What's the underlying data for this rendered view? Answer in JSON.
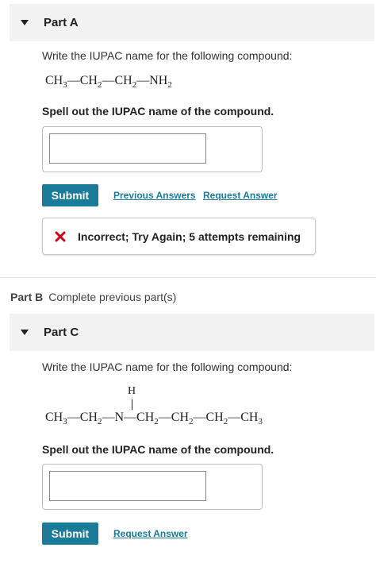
{
  "part_a": {
    "title": "Part A",
    "question": "Write the IUPAC name for the following compound:",
    "formula": [
      {
        "t": "CH",
        "s": "3"
      },
      {
        "b": "—"
      },
      {
        "t": "CH",
        "s": "2"
      },
      {
        "b": "—"
      },
      {
        "t": "CH",
        "s": "2"
      },
      {
        "b": "—"
      },
      {
        "t": "NH",
        "s": "2"
      }
    ],
    "prompt": "Spell out the IUPAC name of the compound.",
    "answer_value": "",
    "submit_label": "Submit",
    "previous_answers_label": "Previous Answers",
    "request_answer_label": "Request Answer",
    "feedback": "Incorrect; Try Again; 5 attempts remaining"
  },
  "part_b": {
    "label": "Part B",
    "text": "Complete previous part(s)"
  },
  "part_c": {
    "title": "Part C",
    "question": "Write the IUPAC name for the following compound:",
    "formula_h": "H",
    "formula": [
      {
        "t": "CH",
        "s": "3"
      },
      {
        "b": "—"
      },
      {
        "t": "CH",
        "s": "2"
      },
      {
        "b": "—"
      },
      {
        "t": "N",
        "s": ""
      },
      {
        "b": "—"
      },
      {
        "t": "CH",
        "s": "2"
      },
      {
        "b": "—"
      },
      {
        "t": "CH",
        "s": "2"
      },
      {
        "b": "—"
      },
      {
        "t": "CH",
        "s": "2"
      },
      {
        "b": "—"
      },
      {
        "t": "CH",
        "s": "3"
      }
    ],
    "prompt": "Spell out the IUPAC name of the compound.",
    "answer_value": "",
    "submit_label": "Submit",
    "request_answer_label": "Request Answer"
  },
  "colors": {
    "accent": "#1b7c9a",
    "error": "#d0021b",
    "header_bg": "#f2f2f2"
  },
  "icons": {
    "collapse": "caret-down-icon",
    "error": "x-icon"
  }
}
